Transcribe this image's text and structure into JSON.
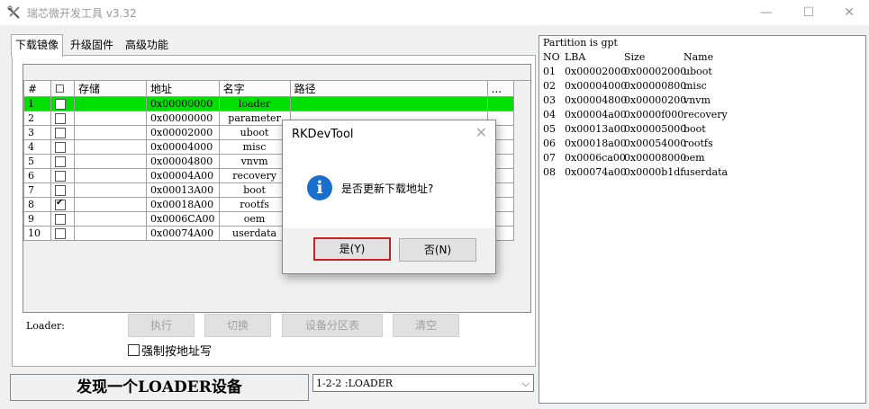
{
  "window": {
    "title": "瑞芯微开发工具 v3.32",
    "minimize": "—",
    "maximize": "☐",
    "close": "✕"
  },
  "tabs": [
    "下载镜像",
    "升级固件",
    "高级功能"
  ],
  "grid": {
    "headers": [
      "#",
      "☐",
      "存储",
      "地址",
      "名字",
      "路径",
      "..."
    ],
    "rows": [
      {
        "num": "1",
        "checked": false,
        "addr": "0x00000000",
        "name": "loader",
        "selected": true
      },
      {
        "num": "2",
        "checked": false,
        "addr": "0x00000000",
        "name": "parameter",
        "selected": false
      },
      {
        "num": "3",
        "checked": false,
        "addr": "0x00002000",
        "name": "uboot",
        "selected": false
      },
      {
        "num": "4",
        "checked": false,
        "addr": "0x00004000",
        "name": "misc",
        "selected": false
      },
      {
        "num": "5",
        "checked": false,
        "addr": "0x00004800",
        "name": "vnvm",
        "selected": false
      },
      {
        "num": "6",
        "checked": false,
        "addr": "0x00004A00",
        "name": "recovery",
        "selected": false
      },
      {
        "num": "7",
        "checked": false,
        "addr": "0x00013A00",
        "name": "boot",
        "selected": false
      },
      {
        "num": "8",
        "checked": true,
        "addr": "0x00018A00",
        "name": "rootfs",
        "selected": false
      },
      {
        "num": "9",
        "checked": false,
        "addr": "0x0006CA00",
        "name": "oem",
        "selected": false
      },
      {
        "num": "10",
        "checked": false,
        "addr": "0x00074A00",
        "name": "userdata",
        "selected": false
      }
    ]
  },
  "loader_label": "Loader:",
  "buttons": {
    "run": "执行",
    "switch": "切换",
    "partition_table": "设备分区表",
    "clear": "清空"
  },
  "force_address_label": "强制按地址写",
  "status_text": "发现一个LOADER设备",
  "device_select_value": "1-2-2 :LOADER",
  "partition_info": {
    "header_line": "Partition is gpt",
    "columns": [
      "NO",
      "LBA",
      "Size",
      "Name"
    ],
    "rows": [
      [
        "01",
        "0x00002000",
        "0x00002000",
        "uboot"
      ],
      [
        "02",
        "0x00004000",
        "0x00000800",
        "misc"
      ],
      [
        "03",
        "0x00004800",
        "0x00000200",
        "vnvm"
      ],
      [
        "04",
        "0x00004a00",
        "0x0000f000",
        "recovery"
      ],
      [
        "05",
        "0x00013a00",
        "0x00005000",
        "boot"
      ],
      [
        "06",
        "0x00018a00",
        "0x00054000",
        "rootfs"
      ],
      [
        "07",
        "0x0006ca00",
        "0x00008000",
        "oem"
      ],
      [
        "08",
        "0x00074a00",
        "0x0000b1df",
        "userdata"
      ]
    ]
  },
  "dialog": {
    "title": "RKDevTool",
    "close": "✕",
    "icon_glyph": "i",
    "message": "是否更新下载地址?",
    "yes": "是(Y)",
    "no": "否(N)"
  }
}
